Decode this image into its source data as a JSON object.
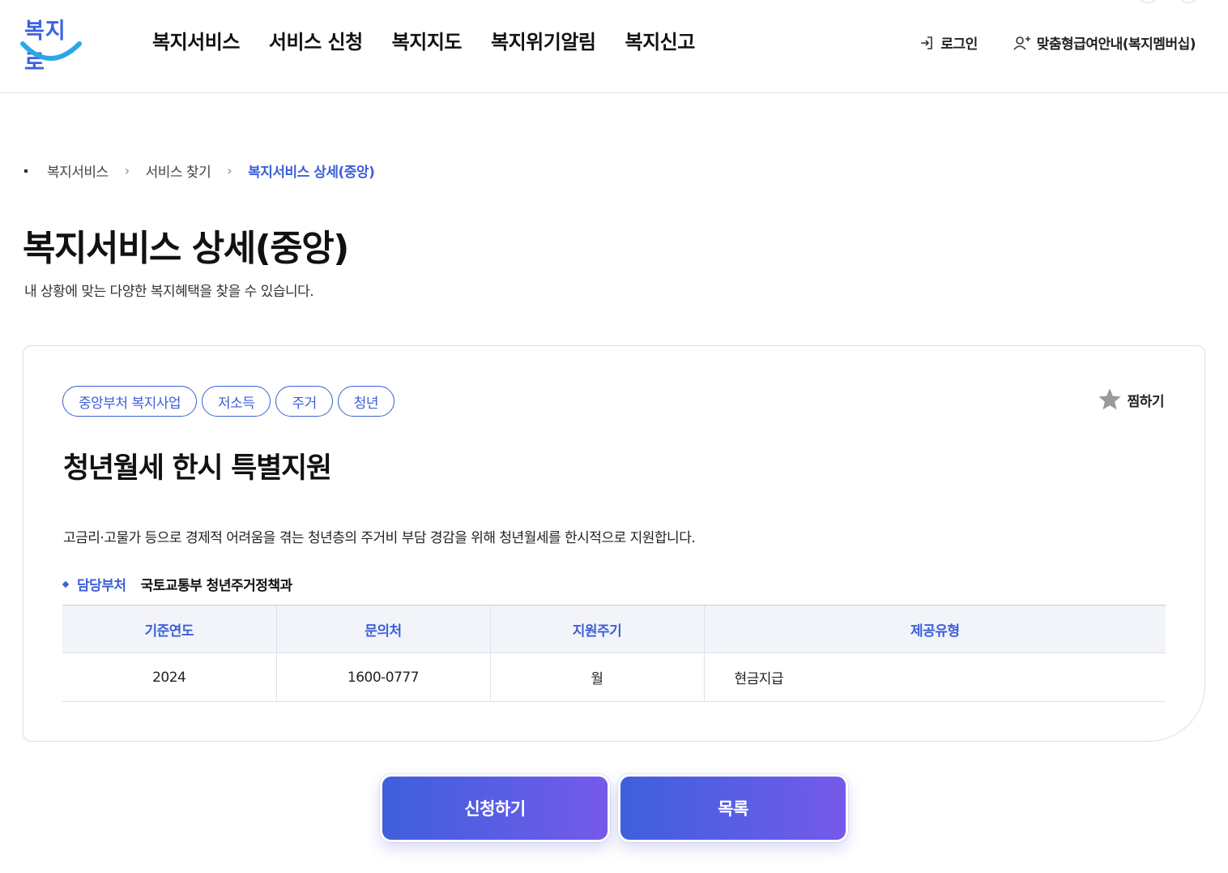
{
  "header": {
    "logo_text": "복지로",
    "nav": [
      "복지서비스",
      "서비스 신청",
      "복지지도",
      "복지위기알림",
      "복지신고"
    ],
    "login_label": "로그인",
    "membership_label": "맞춤형급여안내(복지멤버십)"
  },
  "breadcrumb": {
    "items": [
      "복지서비스",
      "서비스 찾기"
    ],
    "current": "복지서비스 상세(중앙)"
  },
  "page": {
    "title": "복지서비스 상세(중앙)",
    "description": "내 상황에 맞는 다양한 복지혜택을 찾을 수 있습니다."
  },
  "service": {
    "tags": [
      "중앙부처 복지사업",
      "저소득",
      "주거",
      "청년"
    ],
    "favorite_label": "찜하기",
    "title": "청년월세 한시 특별지원",
    "description": "고금리·고물가 등으로 경제적 어려움을 겪는 청년층의 주거비 부담 경감을 위해 청년월세를 한시적으로 지원합니다.",
    "department_label": "담당부처",
    "department_value": "국토교통부 청년주거정책과",
    "table": {
      "headers": [
        "기준연도",
        "문의처",
        "지원주기",
        "제공유형"
      ],
      "row": [
        "2024",
        "1600-0777",
        "월",
        "현금지급"
      ]
    }
  },
  "buttons": {
    "apply": "신청하기",
    "list": "목록"
  },
  "colors": {
    "brand": "#3c5fd8",
    "button_gradient_start": "#3f5fdb",
    "button_gradient_end": "#765ae9",
    "table_header_bg": "#f2f4fa",
    "star_gray": "#9a9a9a"
  },
  "icons": [
    "login-icon",
    "user-plus-icon",
    "star-icon",
    "chevron-right-icon"
  ]
}
